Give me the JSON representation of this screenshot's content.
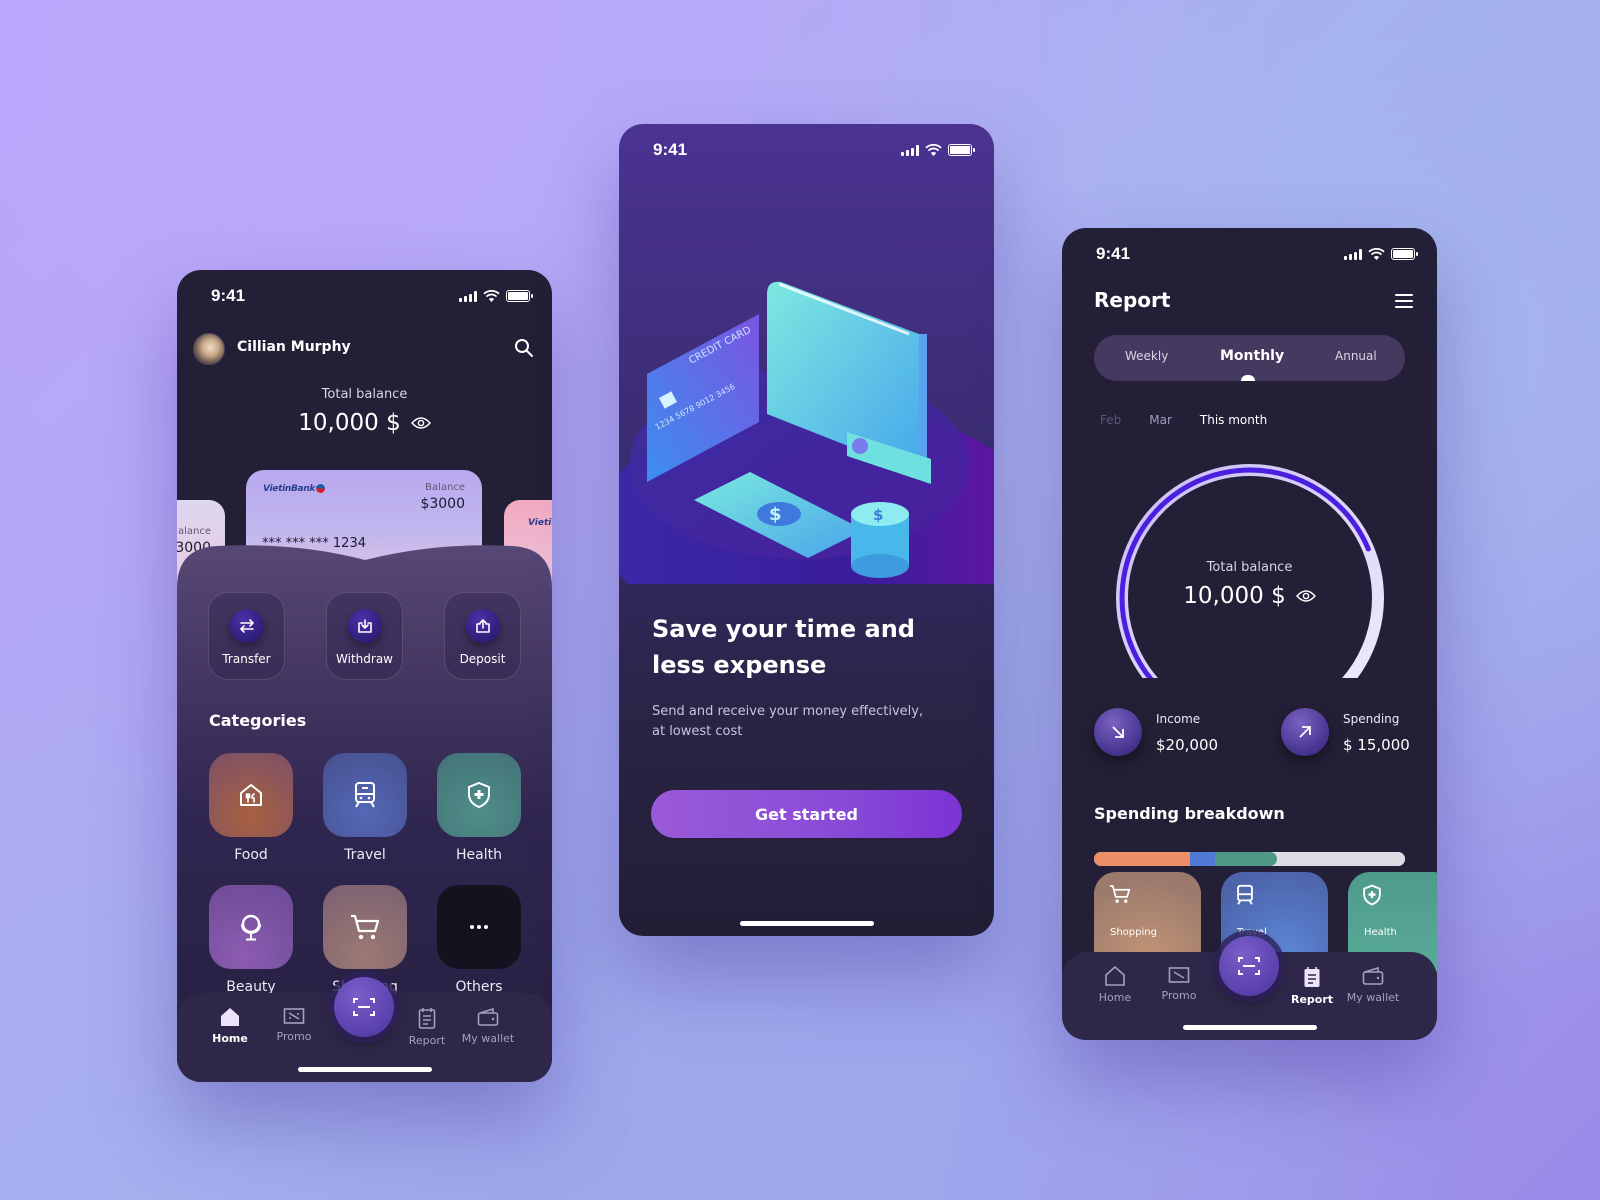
{
  "colors": {
    "accent": "#7a34d4",
    "gauge_progress": "#4a1fe0",
    "food": "#9a5a3f",
    "travel": "#4d5ea8",
    "health": "#4e8c86",
    "beauty": "#7d57a8",
    "shopping": "#8a6a6e",
    "others": "#16111f"
  },
  "status_bar": {
    "time": "9:41"
  },
  "home": {
    "user_name": "Cillian Murphy",
    "total_balance_label": "Total balance",
    "total_balance_value": "10,000 $",
    "cards": {
      "main": {
        "bank": "VietinBank",
        "balance_label": "Balance",
        "balance_value": "$3000",
        "number": "*** *** *** 1234"
      },
      "left": {
        "balance_label": "alance",
        "balance_value": "3000"
      },
      "right": {
        "bank": "VietinB"
      }
    },
    "actions": [
      {
        "label": "Transfer",
        "icon": "transfer-icon"
      },
      {
        "label": "Withdraw",
        "icon": "withdraw-icon"
      },
      {
        "label": "Deposit",
        "icon": "deposit-icon"
      }
    ],
    "categories_title": "Categories",
    "categories": [
      {
        "label": "Food",
        "icon": "restaurant-icon"
      },
      {
        "label": "Travel",
        "icon": "train-icon"
      },
      {
        "label": "Health",
        "icon": "health-shield-icon"
      },
      {
        "label": "Beauty",
        "icon": "mirror-icon"
      },
      {
        "label": "Shopping",
        "icon": "cart-icon"
      },
      {
        "label": "Others",
        "icon": "more-icon"
      }
    ],
    "nav": [
      {
        "label": "Home",
        "active": true
      },
      {
        "label": "Promo",
        "active": false
      },
      {
        "label": "Report",
        "active": false
      },
      {
        "label": "My wallet",
        "active": false
      }
    ]
  },
  "onboarding": {
    "illustration_card_text": "CREDIT CARD",
    "title_line1": "Save your time and",
    "title_line2": "less expense",
    "subtitle_line1": "Send and receive your money effectively,",
    "subtitle_line2": "at lowest cost",
    "cta_label": "Get started"
  },
  "report": {
    "title": "Report",
    "periods": [
      {
        "label": "Weekly",
        "selected": false
      },
      {
        "label": "Monthly",
        "selected": true
      },
      {
        "label": "Annual",
        "selected": false
      }
    ],
    "months": [
      {
        "label": "Feb",
        "state": "dim"
      },
      {
        "label": "Mar",
        "state": "mid"
      },
      {
        "label": "This month",
        "state": "active"
      }
    ],
    "gauge": {
      "label": "Total balance",
      "value": "10,000 $",
      "progress_fraction": 0.75
    },
    "income": {
      "label": "Income",
      "value": "$20,000"
    },
    "spending": {
      "label": "Spending",
      "value": "$ 15,000"
    },
    "breakdown_title": "Spending breakdown",
    "breakdown": [
      {
        "name": "Shopping",
        "fraction": 0.31,
        "color": "#ee8f68"
      },
      {
        "name": "Travel",
        "fraction": 0.08,
        "color": "#5079d6"
      },
      {
        "name": "Health",
        "fraction": 0.2,
        "color": "#4f9885"
      },
      {
        "name": "Remaining",
        "fraction": 0.41,
        "color": "#dcdbe6"
      }
    ],
    "tiles": [
      {
        "label": "Shopping"
      },
      {
        "label": "Travel"
      },
      {
        "label": "Health"
      }
    ],
    "nav": [
      {
        "label": "Home",
        "active": false
      },
      {
        "label": "Promo",
        "active": false
      },
      {
        "label": "Report",
        "active": true
      },
      {
        "label": "My wallet",
        "active": false
      }
    ]
  }
}
